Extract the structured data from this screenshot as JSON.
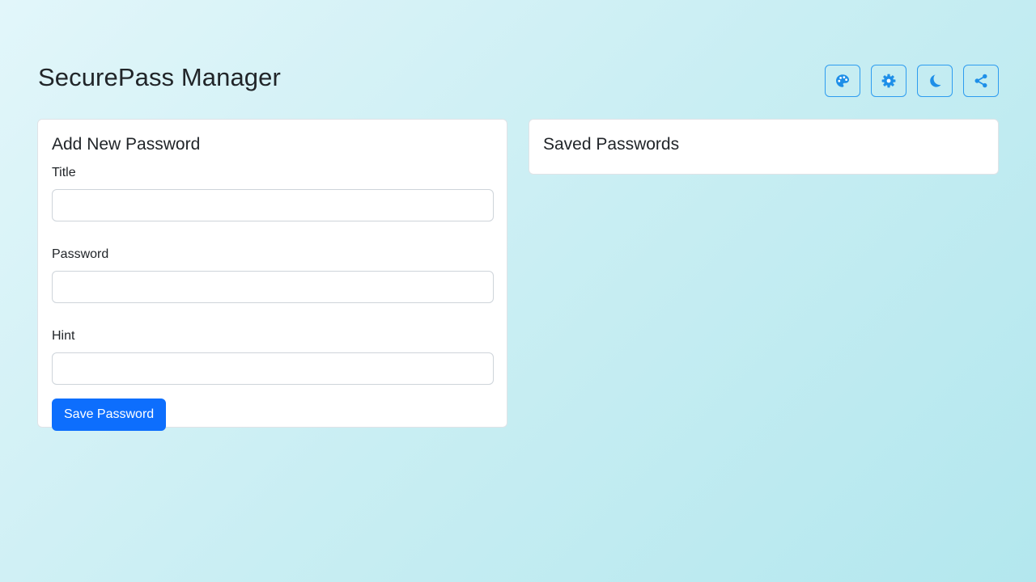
{
  "app": {
    "title": "SecurePass Manager"
  },
  "toolbar": {
    "buttons": [
      {
        "icon": "palette-icon"
      },
      {
        "icon": "gear-icon"
      },
      {
        "icon": "moon-icon"
      },
      {
        "icon": "share-icon"
      }
    ],
    "accent_color": "#2d9cf0"
  },
  "add_card": {
    "title": "Add New Password",
    "fields": [
      {
        "label": "Title",
        "value": "",
        "placeholder": ""
      },
      {
        "label": "Password",
        "value": "",
        "placeholder": ""
      },
      {
        "label": "Hint",
        "value": "",
        "placeholder": ""
      }
    ],
    "save_label": "Save Password",
    "save_color": "#0d6efd"
  },
  "saved_card": {
    "title": "Saved Passwords"
  }
}
